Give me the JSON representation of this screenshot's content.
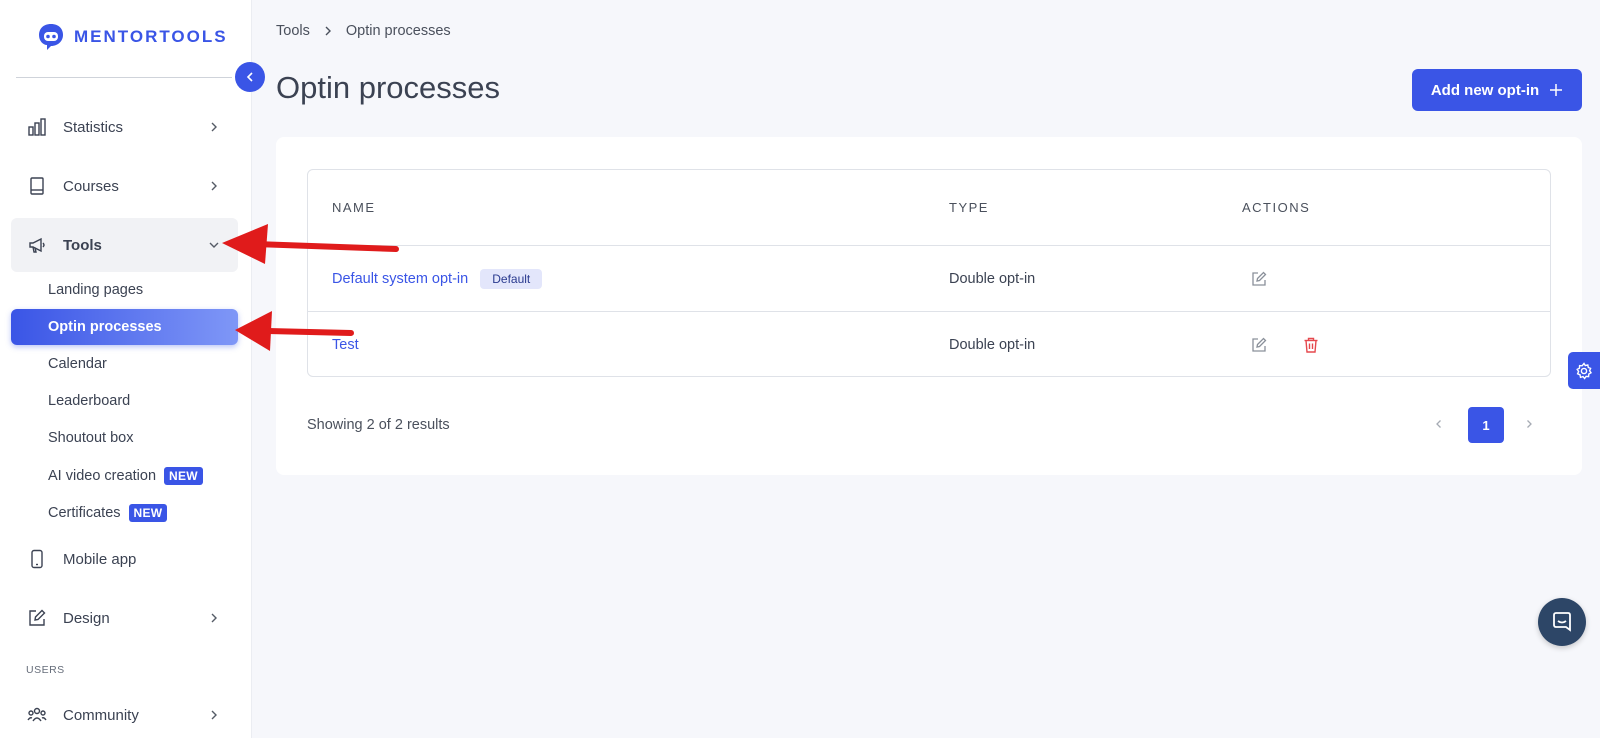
{
  "brand": {
    "name": "MENTORTOOLS"
  },
  "colors": {
    "primary": "#3a55e6",
    "danger": "#e5484d",
    "arrow": "#e01b1b",
    "chat": "#2d4667"
  },
  "sidebar": {
    "nav": [
      {
        "label": "Statistics",
        "icon": "bar-chart-icon"
      },
      {
        "label": "Courses",
        "icon": "book-icon"
      },
      {
        "label": "Tools",
        "icon": "megaphone-icon",
        "open": true
      }
    ],
    "tools_sub": [
      {
        "label": "Landing pages"
      },
      {
        "label": "Optin processes",
        "active": true
      },
      {
        "label": "Calendar"
      },
      {
        "label": "Leaderboard"
      },
      {
        "label": "Shoutout box"
      },
      {
        "label": "AI video creation",
        "badge": "NEW"
      },
      {
        "label": "Certificates",
        "badge": "NEW"
      }
    ],
    "nav_bottom": [
      {
        "label": "Mobile app",
        "icon": "smartphone-icon"
      },
      {
        "label": "Design",
        "icon": "pencil-square-icon"
      }
    ],
    "section_users": "USERS",
    "community": {
      "label": "Community",
      "icon": "users-icon"
    }
  },
  "breadcrumb": {
    "root": "Tools",
    "current": "Optin processes"
  },
  "page": {
    "title": "Optin processes",
    "add_button": "Add new opt-in"
  },
  "table": {
    "headers": {
      "name": "NAME",
      "type": "TYPE",
      "actions": "ACTIONS"
    },
    "rows": [
      {
        "name": "Default system opt-in",
        "badge": "Default",
        "type": "Double opt-in",
        "actions": [
          "edit"
        ]
      },
      {
        "name": "Test",
        "type": "Double opt-in",
        "actions": [
          "edit",
          "delete"
        ]
      }
    ]
  },
  "pagination": {
    "results_text": "Showing 2 of 2 results",
    "current_page": "1"
  }
}
